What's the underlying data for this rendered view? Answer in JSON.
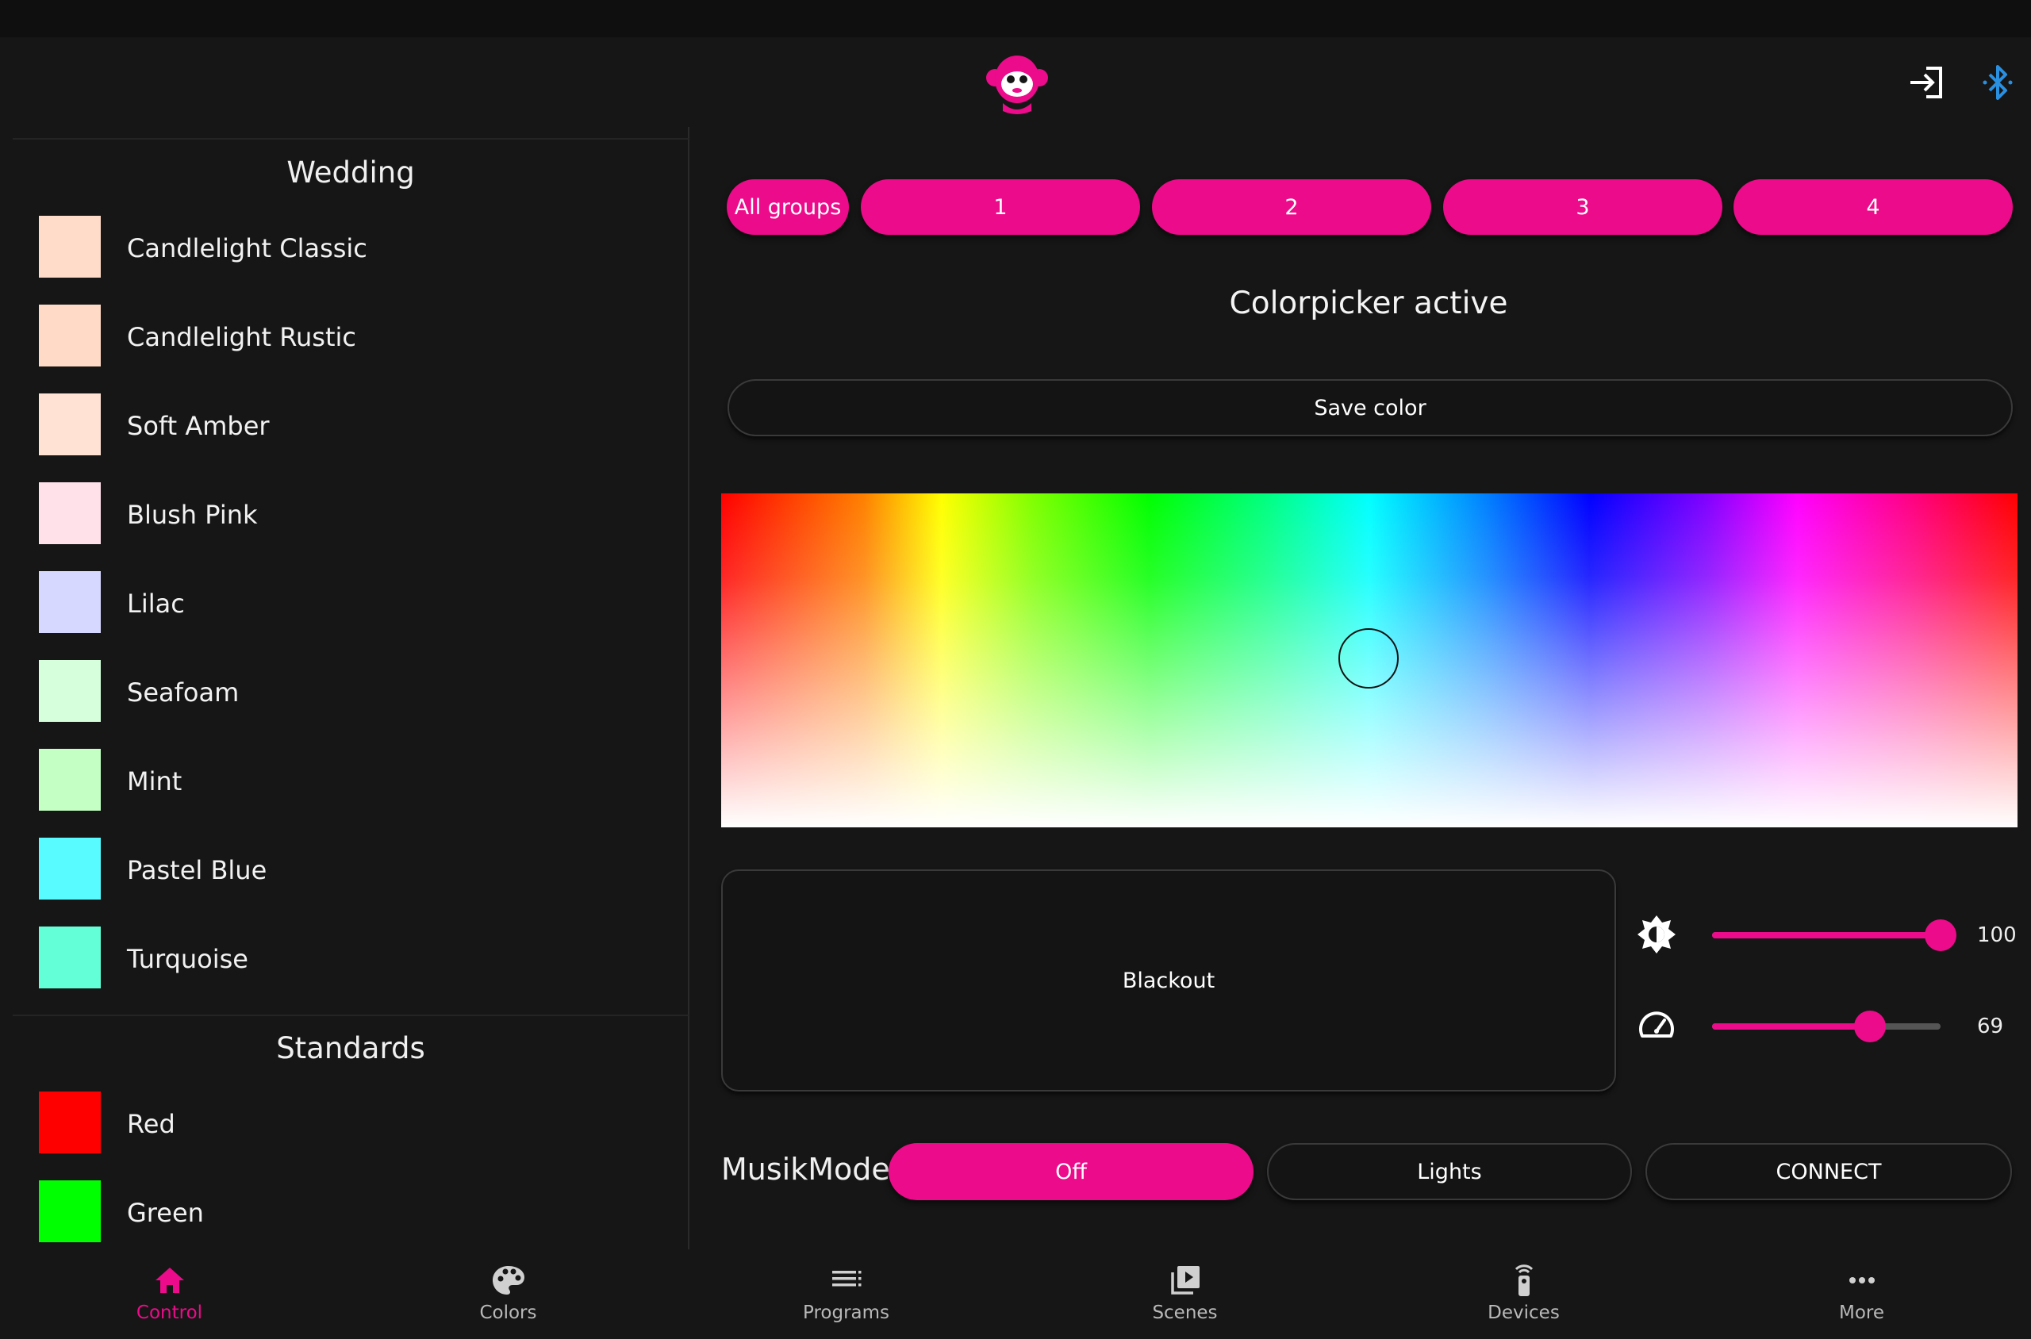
{
  "header": {
    "logo_icon": "monkey-logo-icon",
    "login_icon": "sign-in-icon",
    "bluetooth_icon": "bluetooth-icon"
  },
  "left_panel": {
    "sections": [
      {
        "title": "Wedding",
        "items": [
          {
            "label": "Candlelight Classic",
            "color": "#ffdcc9"
          },
          {
            "label": "Candlelight Rustic",
            "color": "#ffdac6"
          },
          {
            "label": "Soft Amber",
            "color": "#ffe2d4"
          },
          {
            "label": "Blush Pink",
            "color": "#ffe1ea"
          },
          {
            "label": "Lilac",
            "color": "#d7d8ff"
          },
          {
            "label": "Seafoam",
            "color": "#d6ffdc"
          },
          {
            "label": "Mint",
            "color": "#c4ffc4"
          },
          {
            "label": "Pastel Blue",
            "color": "#58fbff"
          },
          {
            "label": "Turquoise",
            "color": "#63ffd7"
          }
        ]
      },
      {
        "title": "Standards",
        "items": [
          {
            "label": "Red",
            "color": "#ff0000"
          },
          {
            "label": "Green",
            "color": "#00ff00"
          }
        ]
      }
    ]
  },
  "groups": {
    "all_label": "All groups",
    "tabs": [
      "1",
      "2",
      "3",
      "4"
    ]
  },
  "status_title": "Colorpicker active",
  "save_color_label": "Save color",
  "blackout_label": "Blackout",
  "brightness": {
    "icon": "brightness-icon",
    "value": "100",
    "level": 100
  },
  "speed": {
    "icon": "speedometer-icon",
    "value": "69",
    "level": 69
  },
  "musik": {
    "label": "MusikMode",
    "off_label": "Off",
    "lights_label": "Lights",
    "connect_label": "CONNECT"
  },
  "nav": {
    "items": [
      {
        "label": "Control",
        "icon": "home-icon",
        "active": true
      },
      {
        "label": "Colors",
        "icon": "palette-icon",
        "active": false
      },
      {
        "label": "Programs",
        "icon": "list-icon",
        "active": false
      },
      {
        "label": "Scenes",
        "icon": "scenes-icon",
        "active": false
      },
      {
        "label": "Devices",
        "icon": "remote-icon",
        "active": false
      },
      {
        "label": "More",
        "icon": "more-icon",
        "active": false
      }
    ]
  },
  "accent_color": "#ec0b8a"
}
